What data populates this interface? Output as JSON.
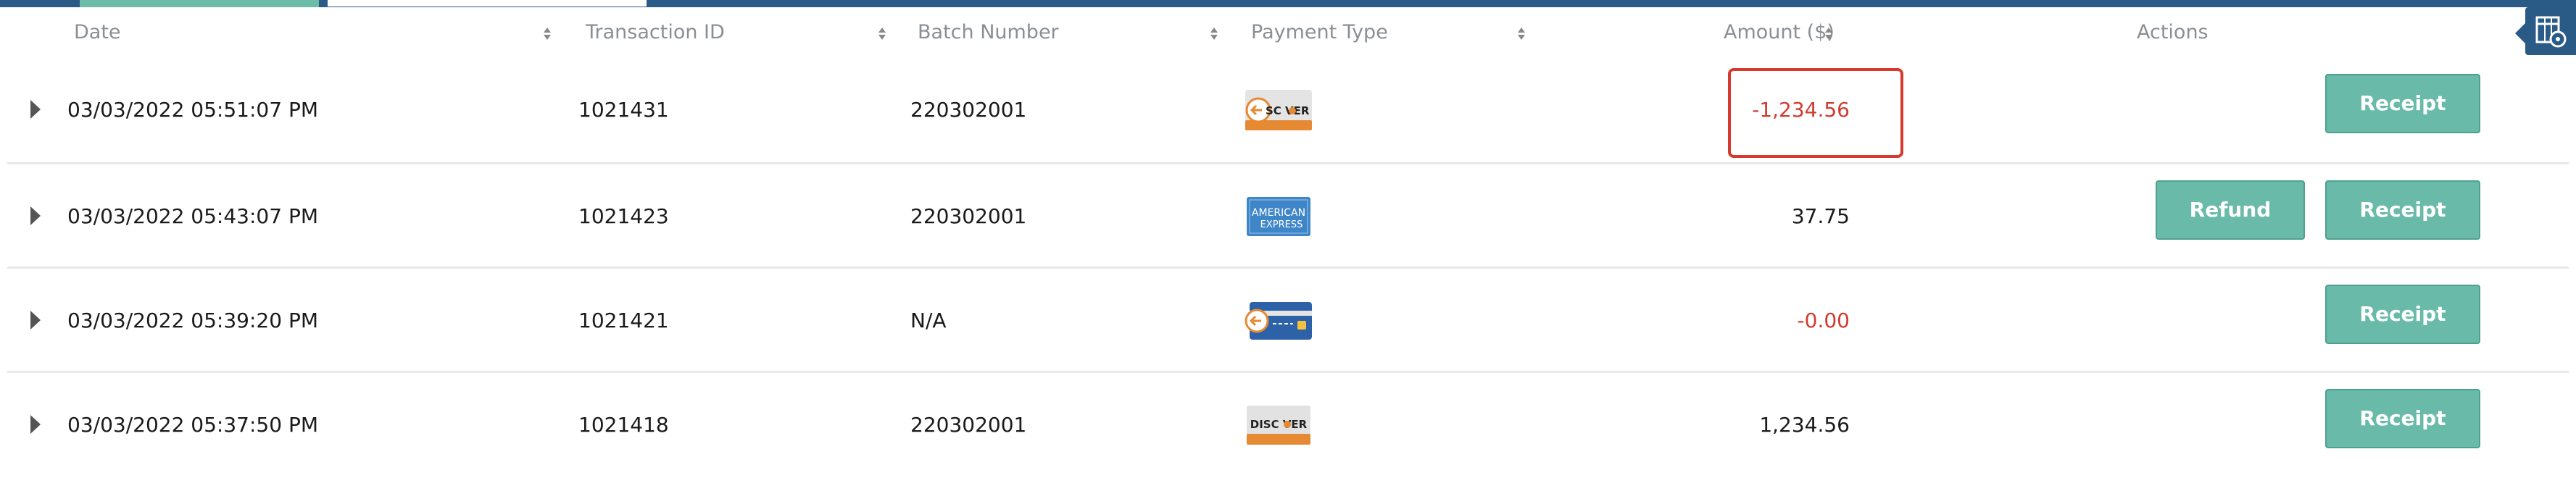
{
  "header": {
    "columns": {
      "date": "Date",
      "transaction_id": "Transaction ID",
      "batch_number": "Batch Number",
      "payment_type": "Payment Type",
      "amount": "Amount ($)",
      "actions": "Actions"
    }
  },
  "rows": [
    {
      "date": "03/03/2022 05:51:07 PM",
      "transaction_id": "1021431",
      "batch_number": "220302001",
      "payment_type_icon": "discover-card-icon",
      "amount": "-1,234.56",
      "amount_negative": true,
      "highlighted": true,
      "actions": {
        "receipt": "Receipt"
      }
    },
    {
      "date": "03/03/2022 05:43:07 PM",
      "transaction_id": "1021423",
      "batch_number": "220302001",
      "payment_type_icon": "american-express-card-icon",
      "amount": "37.75",
      "amount_negative": false,
      "actions": {
        "refund": "Refund",
        "receipt": "Receipt"
      }
    },
    {
      "date": "03/03/2022 05:39:20 PM",
      "transaction_id": "1021421",
      "batch_number": "N/A",
      "payment_type_icon": "generic-card-icon",
      "amount": "-0.00",
      "amount_negative": true,
      "actions": {
        "receipt": "Receipt"
      }
    },
    {
      "date": "03/03/2022 05:37:50 PM",
      "transaction_id": "1021418",
      "batch_number": "220302001",
      "payment_type_icon": "discover-card-icon",
      "amount": "1,234.56",
      "amount_negative": false,
      "actions": {
        "receipt": "Receipt"
      }
    }
  ],
  "colors": {
    "accent": "#2a5a86",
    "button": "#69baa8",
    "negative": "#d13b2e",
    "highlight": "#d63a2f"
  }
}
